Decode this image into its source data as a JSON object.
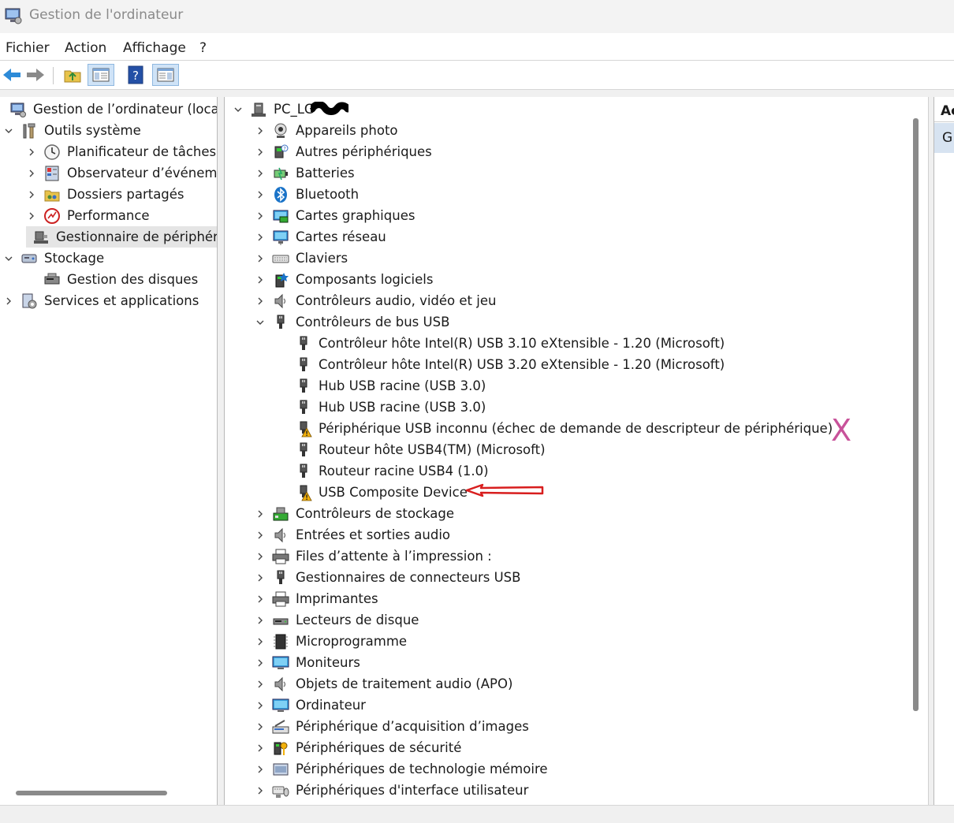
{
  "window": {
    "title": "Gestion de l'ordinateur"
  },
  "menu": [
    "Fichier",
    "Action",
    "Affichage",
    "?"
  ],
  "toolbar": [
    "back-arrow-icon",
    "forward-arrow-icon",
    "up-folder-icon",
    "show-hide-console-tree-icon",
    "help-icon",
    "show-hide-action-pane-icon"
  ],
  "left_tree": [
    {
      "label": "Gestion de l’ordinateur (local)",
      "level": 0,
      "chevron": "none",
      "icon": "computer-management-icon"
    },
    {
      "label": "Outils système",
      "level": 1,
      "chevron": "down",
      "icon": "tools-icon"
    },
    {
      "label": "Planificateur de tâches",
      "level": 2,
      "chevron": "right",
      "icon": "clock-icon"
    },
    {
      "label": "Observateur d’événements",
      "level": 2,
      "chevron": "right",
      "icon": "event-viewer-icon"
    },
    {
      "label": "Dossiers partagés",
      "level": 2,
      "chevron": "right",
      "icon": "shared-folders-icon"
    },
    {
      "label": "Performance",
      "level": 2,
      "chevron": "right",
      "icon": "performance-icon"
    },
    {
      "label": "Gestionnaire de périphériques",
      "level": 2,
      "chevron": "none",
      "icon": "device-manager-icon",
      "selected": true
    },
    {
      "label": "Stockage",
      "level": 1,
      "chevron": "down",
      "icon": "storage-icon"
    },
    {
      "label": "Gestion des disques",
      "level": 2,
      "chevron": "none",
      "icon": "disk-management-icon"
    },
    {
      "label": "Services et applications",
      "level": 1,
      "chevron": "right",
      "icon": "services-icon"
    }
  ],
  "device_tree": {
    "root": {
      "label": "PC_LG",
      "icon": "computer-root-icon"
    },
    "items": [
      {
        "label": "Appareils photo",
        "level": 1,
        "chevron": "right",
        "icon": "camera-icon"
      },
      {
        "label": "Autres périphériques",
        "level": 1,
        "chevron": "right",
        "icon": "other-devices-icon"
      },
      {
        "label": "Batteries",
        "level": 1,
        "chevron": "right",
        "icon": "battery-icon"
      },
      {
        "label": "Bluetooth",
        "level": 1,
        "chevron": "right",
        "icon": "bluetooth-icon"
      },
      {
        "label": "Cartes graphiques",
        "level": 1,
        "chevron": "right",
        "icon": "display-adapter-icon"
      },
      {
        "label": "Cartes réseau",
        "level": 1,
        "chevron": "right",
        "icon": "network-adapter-icon"
      },
      {
        "label": "Claviers",
        "level": 1,
        "chevron": "right",
        "icon": "keyboard-icon"
      },
      {
        "label": "Composants logiciels",
        "level": 1,
        "chevron": "right",
        "icon": "software-component-icon"
      },
      {
        "label": "Contrôleurs audio, vidéo et jeu",
        "level": 1,
        "chevron": "right",
        "icon": "speaker-icon"
      },
      {
        "label": "Contrôleurs de bus USB",
        "level": 1,
        "chevron": "down",
        "icon": "usb-plug-icon"
      },
      {
        "label": "Contrôleur hôte Intel(R) USB 3.10 eXtensible - 1.20 (Microsoft)",
        "level": 2,
        "chevron": "none",
        "icon": "usb-plug-icon"
      },
      {
        "label": "Contrôleur hôte Intel(R) USB 3.20 eXtensible - 1.20 (Microsoft)",
        "level": 2,
        "chevron": "none",
        "icon": "usb-plug-icon"
      },
      {
        "label": "Hub USB racine (USB 3.0)",
        "level": 2,
        "chevron": "none",
        "icon": "usb-plug-icon"
      },
      {
        "label": "Hub USB racine (USB 3.0)",
        "level": 2,
        "chevron": "none",
        "icon": "usb-plug-icon"
      },
      {
        "label": "Périphérique USB inconnu (échec de demande de descripteur de périphérique)",
        "level": 2,
        "chevron": "none",
        "icon": "usb-warning-icon"
      },
      {
        "label": "Routeur hôte USB4(TM) (Microsoft)",
        "level": 2,
        "chevron": "none",
        "icon": "usb-plug-icon"
      },
      {
        "label": "Routeur racine USB4 (1.0)",
        "level": 2,
        "chevron": "none",
        "icon": "usb-plug-icon"
      },
      {
        "label": "USB Composite Device",
        "level": 2,
        "chevron": "none",
        "icon": "usb-warning-icon"
      },
      {
        "label": "Contrôleurs de stockage",
        "level": 1,
        "chevron": "right",
        "icon": "storage-controller-icon"
      },
      {
        "label": "Entrées et sorties audio",
        "level": 1,
        "chevron": "right",
        "icon": "speaker-icon"
      },
      {
        "label": "Files d’attente à l’impression :",
        "level": 1,
        "chevron": "right",
        "icon": "printer-icon"
      },
      {
        "label": "Gestionnaires de connecteurs USB",
        "level": 1,
        "chevron": "right",
        "icon": "usb-plug-icon"
      },
      {
        "label": "Imprimantes",
        "level": 1,
        "chevron": "right",
        "icon": "printer-icon"
      },
      {
        "label": "Lecteurs de disque",
        "level": 1,
        "chevron": "right",
        "icon": "disk-drive-icon"
      },
      {
        "label": "Microprogramme",
        "level": 1,
        "chevron": "right",
        "icon": "firmware-chip-icon"
      },
      {
        "label": "Moniteurs",
        "level": 1,
        "chevron": "right",
        "icon": "monitor-icon"
      },
      {
        "label": "Objets de traitement audio (APO)",
        "level": 1,
        "chevron": "right",
        "icon": "speaker-icon"
      },
      {
        "label": "Ordinateur",
        "level": 1,
        "chevron": "right",
        "icon": "monitor-icon"
      },
      {
        "label": "Périphérique d’acquisition d’images",
        "level": 1,
        "chevron": "right",
        "icon": "scanner-icon"
      },
      {
        "label": "Périphériques de sécurité",
        "level": 1,
        "chevron": "right",
        "icon": "security-key-icon"
      },
      {
        "label": "Périphériques de technologie mémoire",
        "level": 1,
        "chevron": "right",
        "icon": "memory-card-icon"
      },
      {
        "label": "Périphériques d'interface utilisateur",
        "level": 1,
        "chevron": "right",
        "icon": "hid-icon"
      }
    ]
  },
  "right_pane": {
    "header": "Ac",
    "item": "G"
  },
  "annotations": {
    "x_mark": "X"
  },
  "colors": {
    "accent": "#1a73c8",
    "warning": "#f2b10c",
    "annotation_x": "#c8529a",
    "annotation_arrow": "#d81e1e",
    "selection": "#e5e5e5"
  }
}
